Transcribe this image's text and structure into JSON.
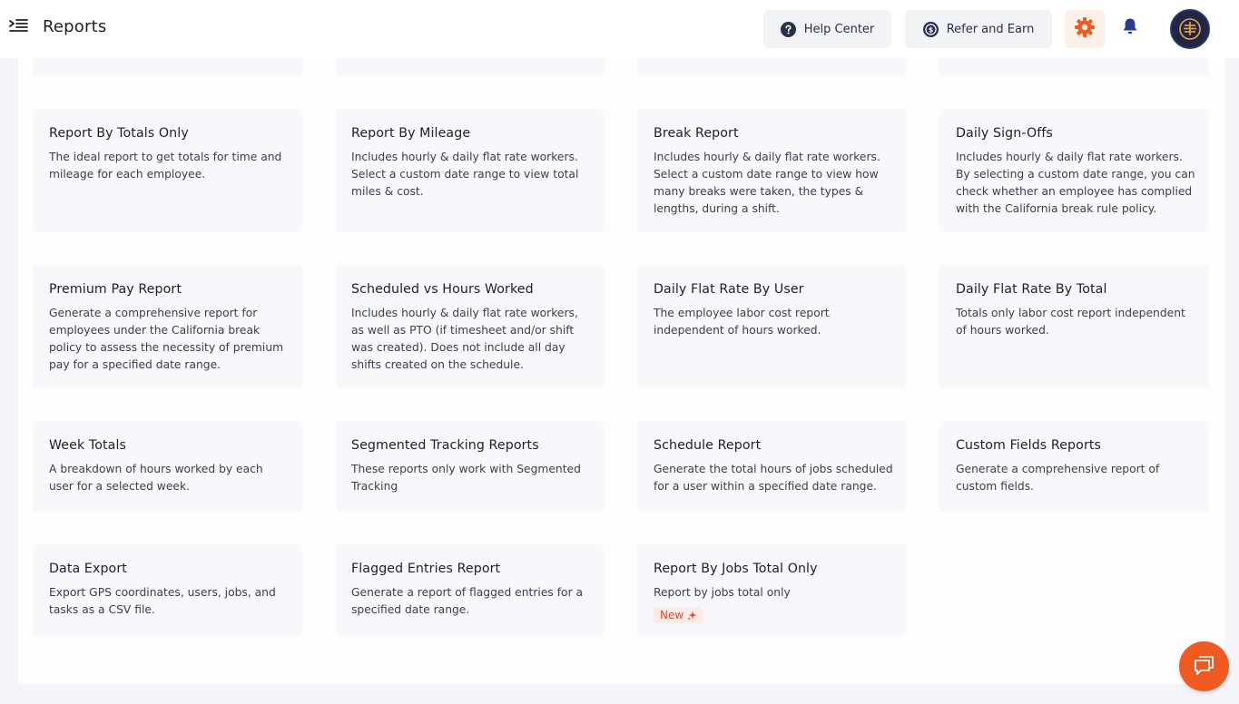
{
  "header": {
    "title": "Reports",
    "help_label": "Help Center",
    "refer_label": "Refer and Earn"
  },
  "colors": {
    "accent": "#ee5a1f",
    "navy": "#27314d",
    "badge_text": "#e4472b"
  },
  "icons": {
    "menu": "menu-collapse-icon",
    "help": "question-circle-icon",
    "refer": "dollar-circle-icon",
    "settings": "gear-icon",
    "notifications": "bell-icon",
    "chat": "chat-icon",
    "badge": "sparkle-icon"
  },
  "reports": [
    {
      "title": "Report By Totals Only",
      "description": "The ideal report to get totals for time and mileage for each employee."
    },
    {
      "title": "Report By Mileage",
      "description": "Includes hourly & daily flat rate workers. Select a custom date range to view total miles & cost."
    },
    {
      "title": "Break Report",
      "description": "Includes hourly & daily flat rate workers. Select a custom date range to view how many breaks were taken, the types & lengths, during a shift."
    },
    {
      "title": "Daily Sign-Offs",
      "description": "Includes hourly & daily flat rate workers. By selecting a custom date range, you can check whether an employee has complied with the California break rule policy."
    },
    {
      "title": "Premium Pay Report",
      "description": "Generate a comprehensive report for employees under the California break policy to assess the necessity of premium pay for a specified date range."
    },
    {
      "title": "Scheduled vs Hours Worked",
      "description": "Includes hourly & daily flat rate workers, as well as PTO (if timesheet and/or shift was created). Does not include all day shifts created on the schedule."
    },
    {
      "title": "Daily Flat Rate By User",
      "description": "The employee labor cost report independent of hours worked."
    },
    {
      "title": "Daily Flat Rate By Total",
      "description": "Totals only labor cost report independent of hours worked."
    },
    {
      "title": "Week Totals",
      "description": "A breakdown of hours worked by each user for a selected week."
    },
    {
      "title": "Segmented Tracking Reports",
      "description": "These reports only work with Segmented Tracking"
    },
    {
      "title": "Schedule Report",
      "description": "Generate the total hours of jobs scheduled for a user within a specified date range."
    },
    {
      "title": "Custom Fields Reports",
      "description": "Generate a comprehensive report of custom fields."
    },
    {
      "title": "Data Export",
      "description": "Export GPS coordinates, users, jobs, and tasks as a CSV file."
    },
    {
      "title": "Flagged Entries Report",
      "description": "Generate a report of flagged entries for a specified date range."
    },
    {
      "title": "Report By  Jobs Total Only",
      "description": "Report by jobs total only",
      "badge": "New"
    }
  ]
}
